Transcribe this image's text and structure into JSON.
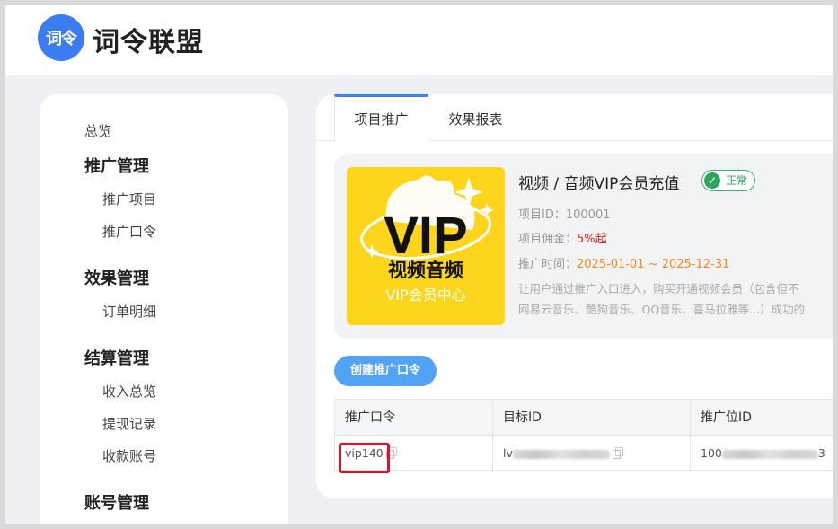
{
  "header": {
    "logo_text": "词令",
    "brand": "词令联盟"
  },
  "sidebar": {
    "overview": "总览",
    "groups": [
      {
        "title": "推广管理",
        "items": [
          "推广项目",
          "推广口令"
        ]
      },
      {
        "title": "效果管理",
        "items": [
          "订单明细"
        ]
      },
      {
        "title": "结算管理",
        "items": [
          "收入总览",
          "提现记录",
          "收款账号"
        ]
      },
      {
        "title": "账号管理",
        "items": []
      }
    ]
  },
  "tabs": [
    "项目推广",
    "效果报表"
  ],
  "project": {
    "image": {
      "big": "VIP",
      "line2": "视频音频",
      "line3": "VIP会员中心"
    },
    "title": "视频 / 音频VIP会员充值",
    "status": "正常",
    "id_label": "项目ID：",
    "id_value": "100001",
    "commission_label": "项目佣金：",
    "commission_value": "5%起",
    "time_label": "推广时间：",
    "time_value": "2025-01-01 ~ 2025-12-31",
    "desc_line1": "让用户通过推广入口进入，购买开通视频会员（包含但不",
    "desc_line2": "网易云音乐、酷狗音乐、QQ音乐、喜马拉雅等...）成功的"
  },
  "create_button": "创建推广口令",
  "table": {
    "headers": [
      "推广口令",
      "目标ID",
      "推广位ID"
    ],
    "rows": [
      {
        "code": "vip140",
        "target_prefix": "lv",
        "position_prefix": "100",
        "position_suffix": "3"
      }
    ]
  },
  "colors": {
    "accent": "#3b82f6",
    "status_green": "#2ea55f",
    "commission_red": "#e02020",
    "time_orange": "#f0891a",
    "highlight_red": "#e0102a"
  }
}
